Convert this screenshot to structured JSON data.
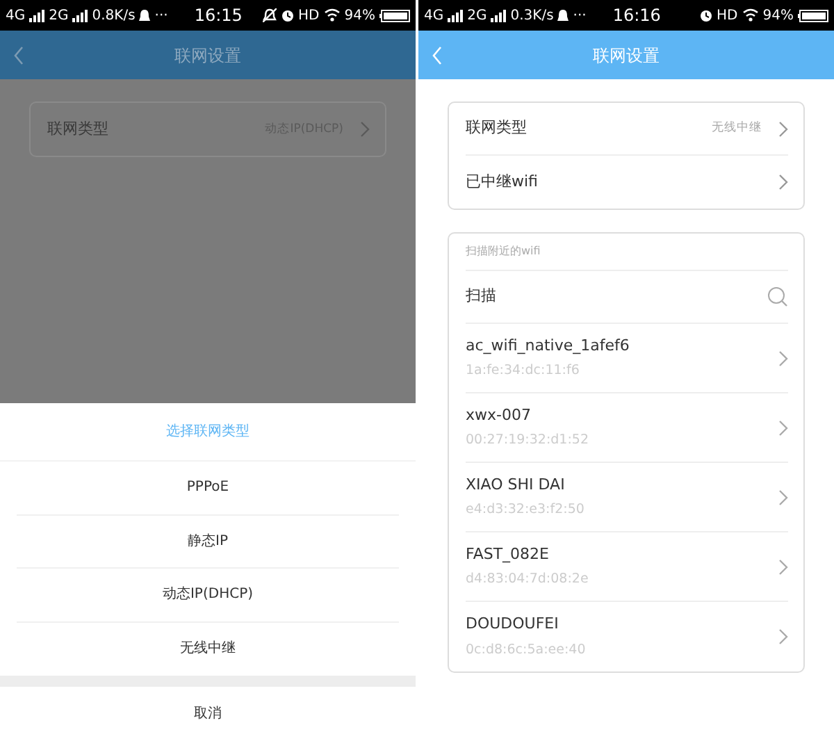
{
  "screens": [
    {
      "dimmed": true,
      "status_bar": {
        "network_1": "4G",
        "network_2": "2G",
        "speed": "0.8K/s",
        "more": "···",
        "time": "16:15",
        "silent": true,
        "hd": "HD",
        "battery": "94%"
      },
      "header": {
        "title": "联网设置"
      },
      "settings": [
        {
          "label": "联网类型",
          "value": "动态IP(DHCP)"
        }
      ],
      "sheet": {
        "title": "选择联网类型",
        "options": [
          "PPPoE",
          "静态IP",
          "动态IP(DHCP)",
          "无线中继"
        ],
        "cancel": "取消"
      }
    },
    {
      "dimmed": false,
      "status_bar": {
        "network_1": "4G",
        "network_2": "2G",
        "speed": "0.3K/s",
        "more": "···",
        "time": "16:16",
        "silent": false,
        "hd": "HD",
        "battery": "94%"
      },
      "header": {
        "title": "联网设置"
      },
      "settings": [
        {
          "label": "联网类型",
          "value": "无线中继"
        },
        {
          "label": "已中继wifi"
        }
      ],
      "scan": {
        "title": "扫描附近的wifi",
        "action": "扫描",
        "networks": [
          {
            "name": "ac_wifi_native_1afef6",
            "mac": "1a:fe:34:dc:11:f6"
          },
          {
            "name": "xwx-007",
            "mac": "00:27:19:32:d1:52"
          },
          {
            "name": "XIAO SHI DAI",
            "mac": "e4:d3:32:e3:f2:50"
          },
          {
            "name": "FAST_082E",
            "mac": "d4:83:04:7d:08:2e"
          },
          {
            "name": "DOUDOUFEI",
            "mac": "0c:d8:6c:5a:ee:40"
          }
        ]
      }
    }
  ]
}
